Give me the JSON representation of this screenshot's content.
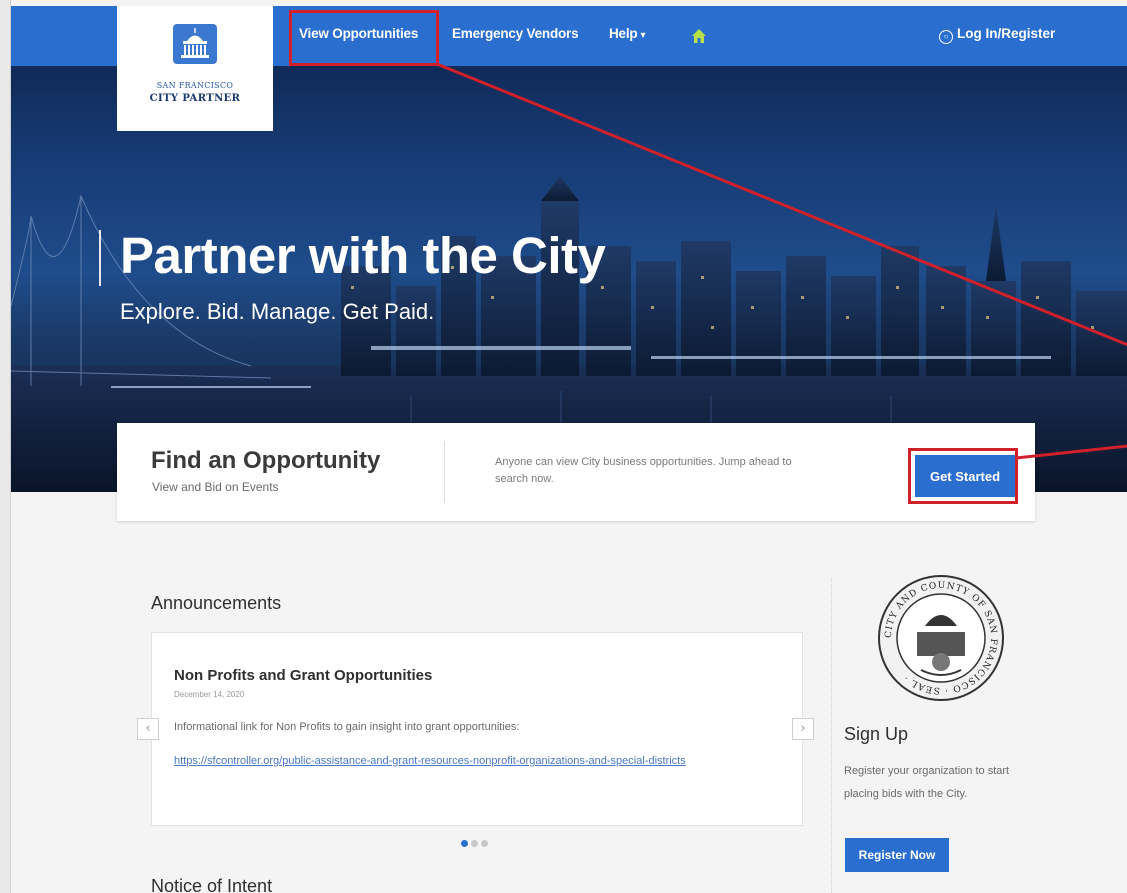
{
  "nav": {
    "view_opportunities": "View Opportunities",
    "emergency_vendors": "Emergency Vendors",
    "help": "Help",
    "help_caret": "▾",
    "login_register": "Log In/Register",
    "home_icon": "home-icon",
    "user_icon": "user-circle-icon"
  },
  "logo": {
    "line1": "SAN FRANCISCO",
    "line2": "CITY PARTNER"
  },
  "hero": {
    "title": "Partner with the City",
    "subtitle": "Explore. Bid. Manage. Get Paid."
  },
  "find": {
    "title": "Find an Opportunity",
    "subtitle": "View and Bid on Events",
    "description": "Anyone can view City business opportunities. Jump ahead to search now.",
    "button": "Get Started"
  },
  "announcements": {
    "heading": "Announcements",
    "item_title": "Non Profits and Grant Opportunities",
    "item_date": "December 14, 2020",
    "item_body": "Informational link for Non Profits to gain insight into grant opportunities:",
    "item_link": "https://sfcontroller.org/public-assistance-and-grant-resources-nonprofit-organizations-and-special-districts",
    "prev_arrow": "‹",
    "next_arrow": "›",
    "slide_count": 3,
    "active_slide": 1
  },
  "notice": {
    "heading": "Notice of Intent"
  },
  "signup": {
    "heading": "Sign Up",
    "description": "Register your organization to start placing bids with the City.",
    "button": "Register Now"
  },
  "colors": {
    "nav_blue": "#2a6ed0",
    "annotation_red": "#d0202a",
    "link_blue": "#4a78c4"
  }
}
